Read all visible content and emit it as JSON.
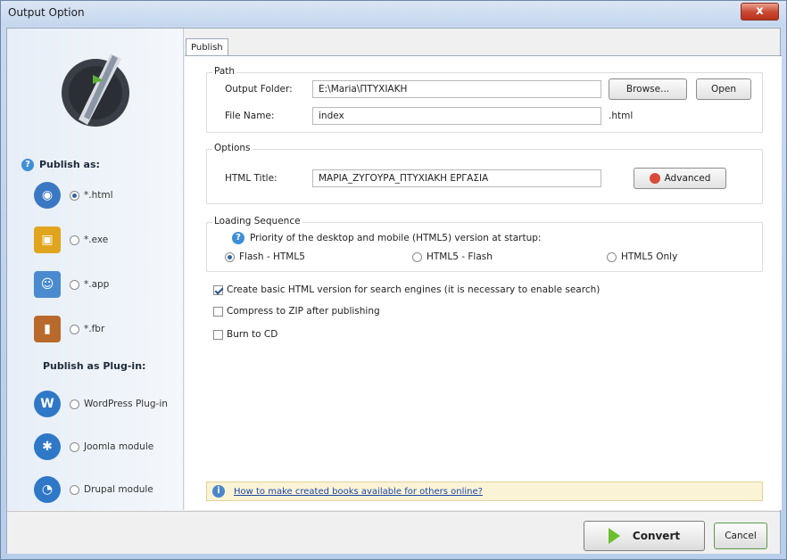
{
  "window": {
    "title": "Output Option",
    "close_glyph": "x"
  },
  "left": {
    "publish_as": "Publish as:",
    "formats": [
      {
        "label": "*.html",
        "icon": "globe-icon",
        "color": "#3b78c4",
        "selected": true
      },
      {
        "label": "*.exe",
        "icon": "package-icon",
        "color": "#e0a41e",
        "selected": false
      },
      {
        "label": "*.app",
        "icon": "mac-finder-icon",
        "color": "#4a8bd0",
        "selected": false
      },
      {
        "label": "*.fbr",
        "icon": "book-icon",
        "color": "#b86a2c",
        "selected": false
      }
    ],
    "publish_plugin": "Publish as Plug-in:",
    "plugins": [
      {
        "label": "WordPress Plug-in",
        "icon": "wordpress-icon",
        "color": "#2f78c8"
      },
      {
        "label": "Joomla module",
        "icon": "joomla-icon",
        "color": "#2f78c8"
      },
      {
        "label": "Drupal module",
        "icon": "drupal-icon",
        "color": "#2f78c8"
      }
    ]
  },
  "tabs": {
    "publish": "Publish"
  },
  "path": {
    "legend": "Path",
    "output_folder_label": "Output Folder:",
    "output_folder_value": "E:\\Maria\\ΠΤΥΧΙΑΚΗ",
    "browse": "Browse...",
    "open": "Open",
    "file_name_label": "File Name:",
    "file_name_value": "index",
    "extension": ".html"
  },
  "options": {
    "legend": "Options",
    "html_title_label": "HTML Title:",
    "html_title_value": "ΜΑΡΙΑ_ΖΥΓΟΥΡΑ_ΠΤΥΧΙΑΚΗ ΕΡΓΑΣΙΑ",
    "advanced": "Advanced"
  },
  "loading": {
    "legend": "Loading Sequence",
    "priority_text": "Priority of the desktop and mobile (HTML5) version at startup:",
    "choices": [
      "Flash - HTML5",
      "HTML5 - Flash",
      "HTML5 Only"
    ],
    "selected": "Flash - HTML5"
  },
  "checks": {
    "basic_html": "Create basic HTML version for search engines (it is necessary to enable search)",
    "basic_html_checked": true,
    "zip": "Compress to ZIP after publishing",
    "zip_checked": false,
    "cd": "Burn to CD",
    "cd_checked": false
  },
  "info": {
    "link": "How to make created books available for others online?"
  },
  "footer": {
    "convert": "Convert",
    "cancel": "Cancel"
  },
  "colors": {
    "accent": "#3b78c4",
    "convert_arrow": "#6bbf2d",
    "info_bg": "#fbf3d6"
  }
}
